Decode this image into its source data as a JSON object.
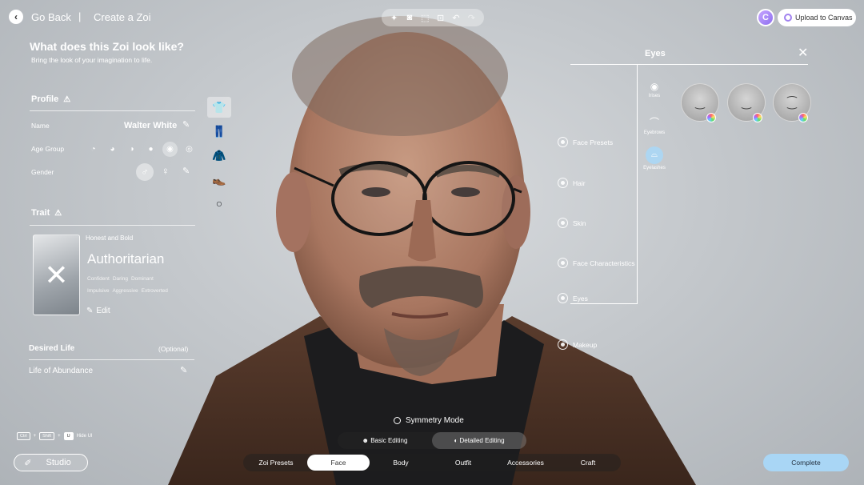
{
  "header": {
    "back_label": "Go Back",
    "separator": "|",
    "crumb": "Create a Zoi",
    "tools": [
      "sparkle-icon",
      "camera-icon",
      "frame-icon",
      "focus-icon",
      "undo-icon",
      "redo-icon"
    ],
    "avatar_letter": "C",
    "upload_label": "Upload to Canvas"
  },
  "panel": {
    "title": "What does this Zoi look like?",
    "subtitle": "Bring the look of your imagination to life."
  },
  "profile": {
    "title": "Profile",
    "name_label": "Name",
    "name_value": "Walter White",
    "age_label": "Age Group",
    "age_groups_selected_index": 4,
    "gender_label": "Gender",
    "gender_selected": "male"
  },
  "trait": {
    "title": "Trait",
    "subtitle": "Honest and Bold",
    "name": "Authoritarian",
    "tags_row1": [
      "Confident",
      "Daring",
      "Dominant"
    ],
    "tags_row2": [
      "Impulsive",
      "Aggressive",
      "Extroverted"
    ],
    "edit_label": "Edit"
  },
  "desired_life": {
    "title": "Desired Life",
    "optional_label": "(Optional)",
    "value": "Life of Abundance"
  },
  "categories": [
    "Face Presets",
    "Hair",
    "Skin",
    "Face Characteristics",
    "Eyes",
    "Makeup"
  ],
  "eyes_panel": {
    "title": "Eyes",
    "subcategories": [
      "Irises",
      "Eyebrows",
      "Eyelashes"
    ],
    "selected_subcategory": "Eyelashes"
  },
  "bottom": {
    "hotkeys": [
      "Ctrl",
      "+",
      "Shift",
      "+",
      "U",
      "Hide UI"
    ],
    "studio_label": "Studio",
    "symmetry_label": "Symmetry Mode",
    "basic_editing": "Basic Editing",
    "detailed_editing": "Detailed Editing",
    "tabs": [
      "Zoi Presets",
      "Face",
      "Body",
      "Outfit",
      "Accessories",
      "Craft"
    ],
    "selected_tab": "Face",
    "complete_label": "Complete"
  },
  "colors": {
    "accent_complete": "#a9d6f5",
    "avatar_purple": "#8e6ff0"
  }
}
